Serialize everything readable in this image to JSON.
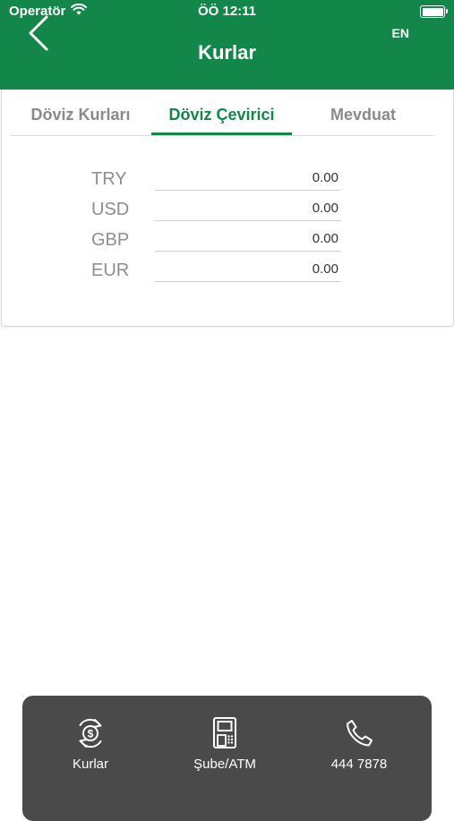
{
  "status_bar": {
    "carrier": "Operatör",
    "time": "ÖÖ 12:11"
  },
  "header": {
    "title": "Kurlar",
    "language_label": "EN",
    "back_icon": "chevron-left-icon"
  },
  "tabs": [
    {
      "label": "Döviz Kurları",
      "active": false
    },
    {
      "label": "Döviz Çevirici",
      "active": true
    },
    {
      "label": "Mevduat",
      "active": false
    }
  ],
  "converter": {
    "rows": [
      {
        "currency": "TRY",
        "value": "0.00"
      },
      {
        "currency": "USD",
        "value": "0.00"
      },
      {
        "currency": "GBP",
        "value": "0.00"
      },
      {
        "currency": "EUR",
        "value": "0.00"
      }
    ]
  },
  "bottom_nav": [
    {
      "label": "Kurlar",
      "icon": "currency-exchange-icon"
    },
    {
      "label": "Şube/ATM",
      "icon": "atm-icon"
    },
    {
      "label": "444 7878",
      "icon": "phone-icon"
    }
  ],
  "colors": {
    "brand_green": "#13874a",
    "bottom_bar": "#4a4a4a",
    "label_gray": "#8e8e8e"
  }
}
